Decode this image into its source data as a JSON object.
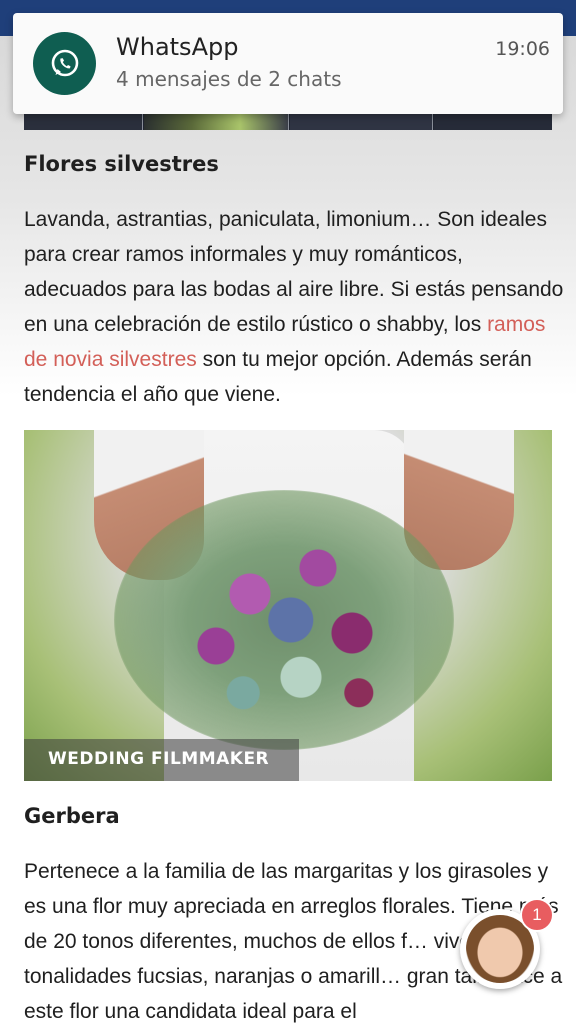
{
  "notification": {
    "app_name": "WhatsApp",
    "message": "4 mensajes de 2 chats",
    "time": "19:06",
    "icon": "whatsapp-icon",
    "icon_color": "#0f5e51"
  },
  "article": {
    "section1": {
      "heading": "Flores silvestres",
      "text_before_link": "Lavanda, astrantias, paniculata, limonium… Son ideales para crear ramos informales y muy románticos, adecuados para las bodas al aire libre. Si estás pensando en una celebración de estilo rústico o shabby, los ",
      "link_text": "ramos de novia silvestres",
      "text_after_link": " son tu mejor opción. Además serán tendencia el año que viene.",
      "link_color": "#d35f58"
    },
    "photo": {
      "caption": "WEDDING FILMMAKER"
    },
    "section2": {
      "heading": "Gerbera",
      "text": "Pertenece a la familia de las margaritas y los girasoles y es una flor muy apreciada en arreglos florales. Tiene más de 20 tonos diferentes, muchos de ellos f… vivos en tonalidades fucsias, naranjas o amarill… gran tallo hace a este flor una candidata ideal para el"
    }
  },
  "chat_bubble": {
    "badge_count": "1",
    "badge_color": "#e85d60"
  }
}
